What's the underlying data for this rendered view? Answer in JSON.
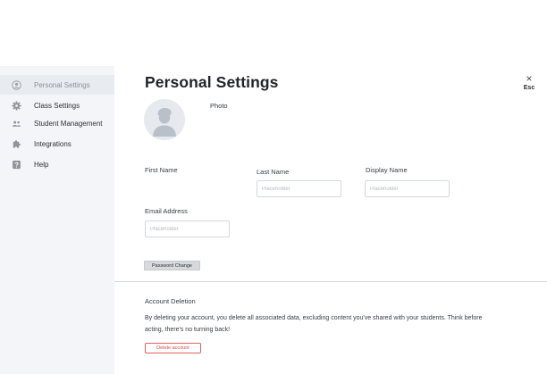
{
  "sidebar": {
    "items": [
      {
        "label": "Personal Settings",
        "icon": "user-circle-icon"
      },
      {
        "label": "Class Settings",
        "icon": "gear-icon"
      },
      {
        "label": "Student Management",
        "icon": "people-icon"
      },
      {
        "label": "Integrations",
        "icon": "puzzle-icon"
      },
      {
        "label": "Help",
        "icon": "help-icon"
      }
    ]
  },
  "header": {
    "title": "Personal Settings",
    "close_x": "×",
    "close_label": "Esc"
  },
  "photo": {
    "label": "Photo"
  },
  "form": {
    "first_name": {
      "label": "First Name"
    },
    "last_name": {
      "label": "Last Name",
      "placeholder": "Placeholder"
    },
    "display_name": {
      "label": "Display Name",
      "placeholder": "Placeholder"
    },
    "email": {
      "label": "Email Address",
      "placeholder": "Placeholder"
    },
    "password_button": "Password  Change"
  },
  "account_deletion": {
    "title": "Account Deletion",
    "description": "By deleting your account, you delete all associated data, excluding content you've shared with your students. Think before acting, there's no turning back!",
    "button": "Delete account"
  },
  "colors": {
    "sidebar_bg": "#f3f5f8",
    "active_item_bg": "#e8ecf1",
    "icon_gray": "#8e949c",
    "danger": "#d94a4a"
  }
}
